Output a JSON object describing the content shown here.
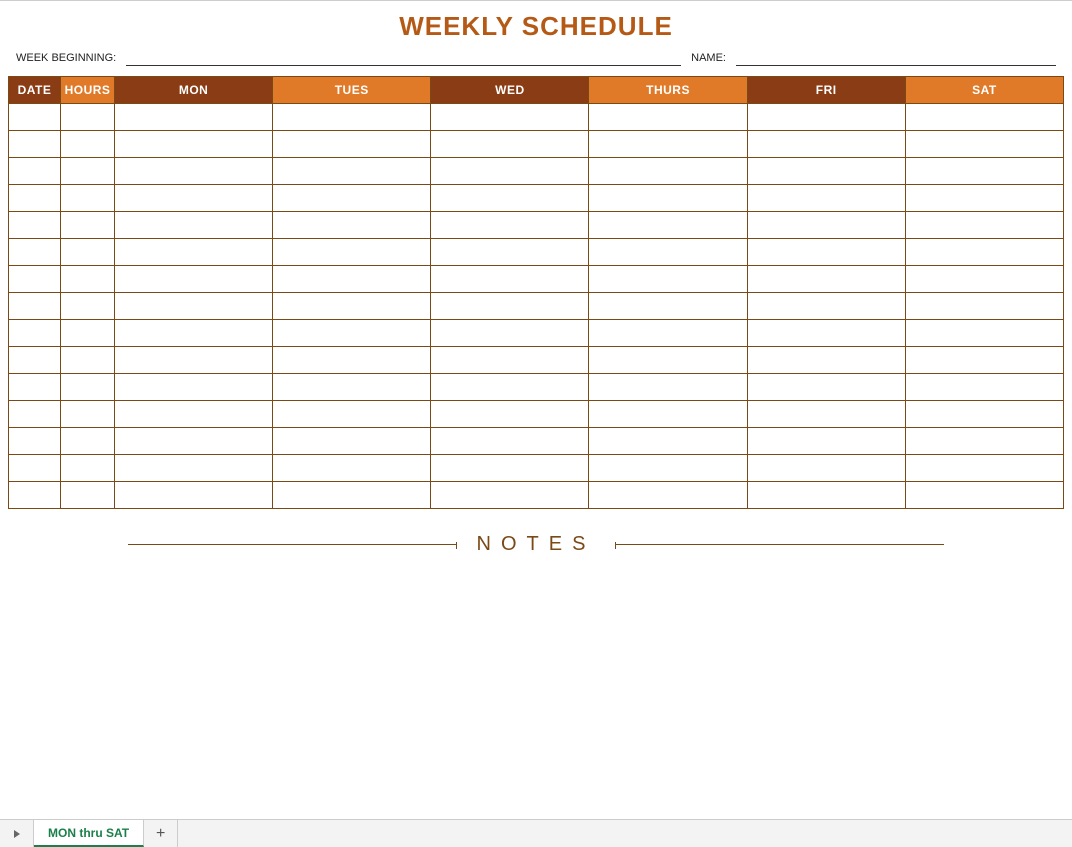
{
  "title": "WEEKLY SCHEDULE",
  "meta": {
    "week_beginning_label": "WEEK BEGINNING:",
    "week_beginning_value": "",
    "name_label": "NAME:",
    "name_value": ""
  },
  "columns": [
    {
      "label": "DATE",
      "style": "brown"
    },
    {
      "label": "HOURS",
      "style": "orange"
    },
    {
      "label": "MON",
      "style": "brown"
    },
    {
      "label": "TUES",
      "style": "orange"
    },
    {
      "label": "WED",
      "style": "brown"
    },
    {
      "label": "THURS",
      "style": "orange"
    },
    {
      "label": "FRI",
      "style": "brown"
    },
    {
      "label": "SAT",
      "style": "orange"
    }
  ],
  "row_count": 15,
  "notes_label": "NOTES",
  "tabs": {
    "active": "MON thru SAT"
  }
}
